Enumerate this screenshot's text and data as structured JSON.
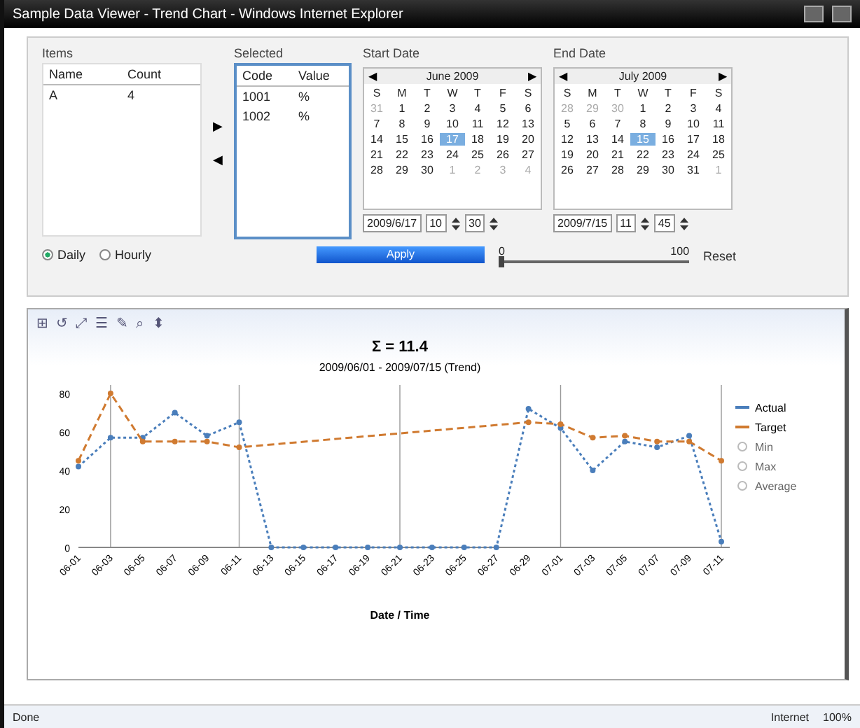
{
  "window": {
    "title": "Sample Data Viewer - Trend Chart - Windows Internet Explorer"
  },
  "list_panel": {
    "label": "Items",
    "columns": [
      "Name",
      "Count"
    ],
    "rows": [
      [
        "A",
        "4"
      ]
    ]
  },
  "table_panel": {
    "label": "Selected",
    "columns": [
      "Code",
      "Value"
    ],
    "rows": [
      [
        "1001",
        "%"
      ],
      [
        "1002",
        "%"
      ]
    ]
  },
  "move_buttons": [
    "▶",
    "◀"
  ],
  "calendars": [
    {
      "label": "Start Date",
      "month": "June 2009",
      "weekdays": [
        "S",
        "M",
        "T",
        "W",
        "T",
        "F",
        "S"
      ],
      "weeks": [
        [
          {
            "day": "31",
            "other": true,
            "selected": false
          },
          {
            "day": "1",
            "other": false,
            "selected": false
          },
          {
            "day": "2",
            "other": false,
            "selected": false
          },
          {
            "day": "3",
            "other": false,
            "selected": false
          },
          {
            "day": "4",
            "other": false,
            "selected": false
          },
          {
            "day": "5",
            "other": false,
            "selected": false
          },
          {
            "day": "6",
            "other": false,
            "selected": false
          }
        ],
        [
          {
            "day": "7",
            "other": false,
            "selected": false
          },
          {
            "day": "8",
            "other": false,
            "selected": false
          },
          {
            "day": "9",
            "other": false,
            "selected": false
          },
          {
            "day": "10",
            "other": false,
            "selected": false
          },
          {
            "day": "11",
            "other": false,
            "selected": false
          },
          {
            "day": "12",
            "other": false,
            "selected": false
          },
          {
            "day": "13",
            "other": false,
            "selected": false
          }
        ],
        [
          {
            "day": "14",
            "other": false,
            "selected": false
          },
          {
            "day": "15",
            "other": false,
            "selected": false
          },
          {
            "day": "16",
            "other": false,
            "selected": false
          },
          {
            "day": "17",
            "other": false,
            "selected": true
          },
          {
            "day": "18",
            "other": false,
            "selected": false
          },
          {
            "day": "19",
            "other": false,
            "selected": false
          },
          {
            "day": "20",
            "other": false,
            "selected": false
          }
        ],
        [
          {
            "day": "21",
            "other": false,
            "selected": false
          },
          {
            "day": "22",
            "other": false,
            "selected": false
          },
          {
            "day": "23",
            "other": false,
            "selected": false
          },
          {
            "day": "24",
            "other": false,
            "selected": false
          },
          {
            "day": "25",
            "other": false,
            "selected": false
          },
          {
            "day": "26",
            "other": false,
            "selected": false
          },
          {
            "day": "27",
            "other": false,
            "selected": false
          }
        ],
        [
          {
            "day": "28",
            "other": false,
            "selected": false
          },
          {
            "day": "29",
            "other": false,
            "selected": false
          },
          {
            "day": "30",
            "other": false,
            "selected": false
          },
          {
            "day": "1",
            "other": true,
            "selected": false
          },
          {
            "day": "2",
            "other": true,
            "selected": false
          },
          {
            "day": "3",
            "other": true,
            "selected": false
          },
          {
            "day": "4",
            "other": true,
            "selected": false
          }
        ]
      ],
      "date": "2009/6/17",
      "hour": "10",
      "minute": "30",
      "prev": "◀",
      "next": "▶"
    },
    {
      "label": "End Date",
      "month": "July 2009",
      "weekdays": [
        "S",
        "M",
        "T",
        "W",
        "T",
        "F",
        "S"
      ],
      "weeks": [
        [
          {
            "day": "28",
            "other": true,
            "selected": false
          },
          {
            "day": "29",
            "other": true,
            "selected": false
          },
          {
            "day": "30",
            "other": true,
            "selected": false
          },
          {
            "day": "1",
            "other": false,
            "selected": false
          },
          {
            "day": "2",
            "other": false,
            "selected": false
          },
          {
            "day": "3",
            "other": false,
            "selected": false
          },
          {
            "day": "4",
            "other": false,
            "selected": false
          }
        ],
        [
          {
            "day": "5",
            "other": false,
            "selected": false
          },
          {
            "day": "6",
            "other": false,
            "selected": false
          },
          {
            "day": "7",
            "other": false,
            "selected": false
          },
          {
            "day": "8",
            "other": false,
            "selected": false
          },
          {
            "day": "9",
            "other": false,
            "selected": false
          },
          {
            "day": "10",
            "other": false,
            "selected": false
          },
          {
            "day": "11",
            "other": false,
            "selected": false
          }
        ],
        [
          {
            "day": "12",
            "other": false,
            "selected": false
          },
          {
            "day": "13",
            "other": false,
            "selected": false
          },
          {
            "day": "14",
            "other": false,
            "selected": false
          },
          {
            "day": "15",
            "other": false,
            "selected": true
          },
          {
            "day": "16",
            "other": false,
            "selected": false
          },
          {
            "day": "17",
            "other": false,
            "selected": false
          },
          {
            "day": "18",
            "other": false,
            "selected": false
          }
        ],
        [
          {
            "day": "19",
            "other": false,
            "selected": false
          },
          {
            "day": "20",
            "other": false,
            "selected": false
          },
          {
            "day": "21",
            "other": false,
            "selected": false
          },
          {
            "day": "22",
            "other": false,
            "selected": false
          },
          {
            "day": "23",
            "other": false,
            "selected": false
          },
          {
            "day": "24",
            "other": false,
            "selected": false
          },
          {
            "day": "25",
            "other": false,
            "selected": false
          }
        ],
        [
          {
            "day": "26",
            "other": false,
            "selected": false
          },
          {
            "day": "27",
            "other": false,
            "selected": false
          },
          {
            "day": "28",
            "other": false,
            "selected": false
          },
          {
            "day": "29",
            "other": false,
            "selected": false
          },
          {
            "day": "30",
            "other": false,
            "selected": false
          },
          {
            "day": "31",
            "other": false,
            "selected": false
          },
          {
            "day": "1",
            "other": true,
            "selected": false
          }
        ]
      ],
      "date": "2009/7/15",
      "hour": "11",
      "minute": "45",
      "prev": "◀",
      "next": "▶"
    }
  ],
  "radios": [
    {
      "label": "Daily",
      "selected": true
    },
    {
      "label": "Hourly",
      "selected": false
    }
  ],
  "apply_button": "Apply",
  "slider": {
    "min_label": "0",
    "max_label": "100",
    "level": 0.0
  },
  "reset_link": "Reset",
  "chart_panel": {
    "toolbar": [
      "⊞",
      "↺",
      "⤢",
      "☰",
      "✎",
      "⌕",
      "⬍"
    ],
    "chart_data": {
      "type": "line",
      "title": "Σ = 11.4",
      "subtitle": "2009/06/01 - 2009/07/15 (Trend)",
      "xlabel": "Date / Time",
      "categories": [
        "06-01",
        "06-03",
        "06-05",
        "06-07",
        "06-09",
        "06-11",
        "06-13",
        "06-15",
        "06-17",
        "06-19",
        "06-21",
        "06-23",
        "06-25",
        "06-27",
        "06-29",
        "07-01",
        "07-03",
        "07-05",
        "07-07",
        "07-09",
        "07-11"
      ],
      "ylim": [
        0,
        80
      ],
      "legend": "right",
      "yticks": [
        0,
        20,
        40,
        60,
        80
      ],
      "series": [
        {
          "name": "Actual",
          "color": "#4a7ebb",
          "line_style": "dotted",
          "marker": "circle",
          "values": [
            42,
            57,
            57,
            70,
            58,
            65,
            0,
            0,
            0,
            0,
            0,
            0,
            0,
            0,
            72,
            62,
            40,
            55,
            52,
            58,
            3
          ]
        },
        {
          "name": "Target",
          "color": "#d07a30",
          "line_style": "dashed",
          "marker": "circle",
          "values": [
            45,
            80,
            55,
            55,
            55,
            52,
            null,
            null,
            null,
            null,
            null,
            null,
            null,
            null,
            65,
            64,
            57,
            58,
            55,
            55,
            45
          ]
        }
      ]
    },
    "hidden_series": [
      {
        "name": "Min"
      },
      {
        "name": "Max"
      },
      {
        "name": "Average"
      }
    ]
  },
  "status_bar": {
    "left": "Done",
    "zone": "Internet",
    "zoom": "100%"
  }
}
